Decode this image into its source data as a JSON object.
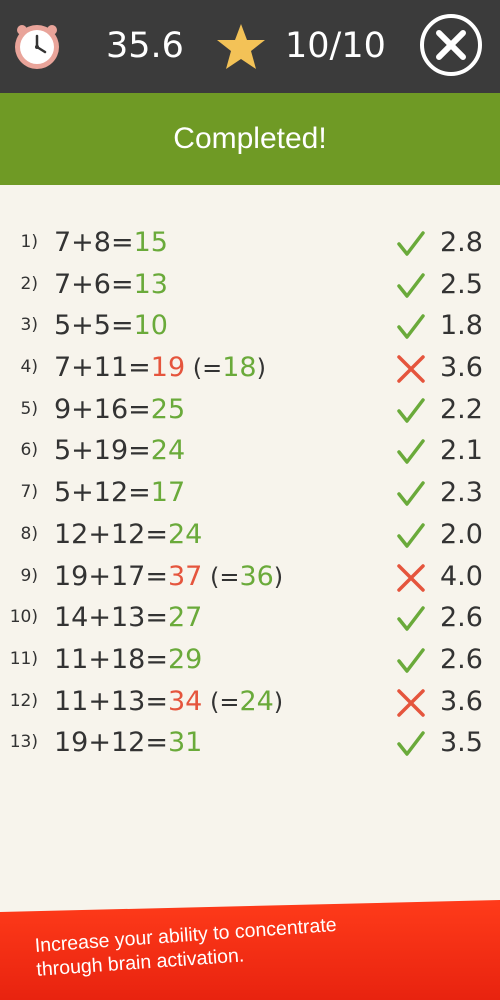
{
  "header": {
    "time": "35.6",
    "score": "10/10"
  },
  "banner": {
    "title": "Completed!"
  },
  "rows": [
    {
      "num": "1)",
      "expr": "7+8=",
      "answer": "15",
      "correct": "",
      "ok": true,
      "time": "2.8"
    },
    {
      "num": "2)",
      "expr": "7+6=",
      "answer": "13",
      "correct": "",
      "ok": true,
      "time": "2.5"
    },
    {
      "num": "3)",
      "expr": "5+5=",
      "answer": "10",
      "correct": "",
      "ok": true,
      "time": "1.8"
    },
    {
      "num": "4)",
      "expr": "7+11=",
      "answer": "19",
      "correct": "18",
      "ok": false,
      "time": "3.6"
    },
    {
      "num": "5)",
      "expr": "9+16=",
      "answer": "25",
      "correct": "",
      "ok": true,
      "time": "2.2"
    },
    {
      "num": "6)",
      "expr": "5+19=",
      "answer": "24",
      "correct": "",
      "ok": true,
      "time": "2.1"
    },
    {
      "num": "7)",
      "expr": "5+12=",
      "answer": "17",
      "correct": "",
      "ok": true,
      "time": "2.3"
    },
    {
      "num": "8)",
      "expr": "12+12=",
      "answer": "24",
      "correct": "",
      "ok": true,
      "time": "2.0"
    },
    {
      "num": "9)",
      "expr": "19+17=",
      "answer": "37",
      "correct": "36",
      "ok": false,
      "time": "4.0"
    },
    {
      "num": "10)",
      "expr": "14+13=",
      "answer": "27",
      "correct": "",
      "ok": true,
      "time": "2.6"
    },
    {
      "num": "11)",
      "expr": "11+18=",
      "answer": "29",
      "correct": "",
      "ok": true,
      "time": "2.6"
    },
    {
      "num": "12)",
      "expr": "11+13=",
      "answer": "34",
      "correct": "24",
      "ok": false,
      "time": "3.6"
    },
    {
      "num": "13)",
      "expr": "19+12=",
      "answer": "31",
      "correct": "",
      "ok": true,
      "time": "3.5"
    }
  ],
  "footer": {
    "line1": "Increase your ability to concentrate",
    "line2": "through brain activation."
  },
  "colors": {
    "correct": "#6aaa3a",
    "wrong": "#e5553d",
    "banner": "#6f9a25",
    "topbar": "#3b3b3b",
    "footer": "#ff3b1a"
  },
  "icons": {
    "timer": "clock-icon",
    "score": "star-icon",
    "close": "close-icon",
    "correct": "check-icon",
    "wrong": "cross-icon"
  }
}
